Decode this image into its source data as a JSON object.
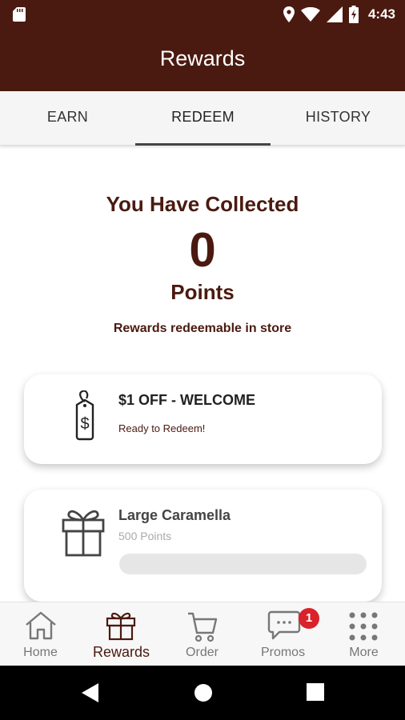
{
  "colors": {
    "brand": "#4a1a10",
    "badge": "#d9222a",
    "progress_track": "#e6e6e6"
  },
  "status_bar": {
    "time": "4:43",
    "icons": [
      "sd-card-icon",
      "location-icon",
      "wifi-icon",
      "signal-icon",
      "battery-charging-icon"
    ]
  },
  "app_bar": {
    "title": "Rewards"
  },
  "tabs": [
    {
      "label": "EARN",
      "active": false
    },
    {
      "label": "REDEEM",
      "active": true
    },
    {
      "label": "HISTORY",
      "active": false
    }
  ],
  "summary": {
    "heading": "You Have Collected",
    "points": "0",
    "points_label": "Points",
    "note": "Rewards redeemable in store"
  },
  "rewards": [
    {
      "title": "$1 OFF - WELCOME",
      "status": "Ready to Redeem!",
      "icon": "price-tag-icon"
    },
    {
      "title": "Large Caramella",
      "points": "500 Points",
      "icon": "gift-icon",
      "progress": 0
    }
  ],
  "bottom_nav": [
    {
      "label": "Home",
      "icon": "home-icon",
      "active": false
    },
    {
      "label": "Rewards",
      "icon": "gift-icon",
      "active": true
    },
    {
      "label": "Order",
      "icon": "cart-icon",
      "active": false
    },
    {
      "label": "Promos",
      "icon": "chat-icon",
      "active": false,
      "badge": "1"
    },
    {
      "label": "More",
      "icon": "grid-icon",
      "active": false
    }
  ],
  "system_nav": [
    "back-icon",
    "home-circle-icon",
    "recents-icon"
  ]
}
